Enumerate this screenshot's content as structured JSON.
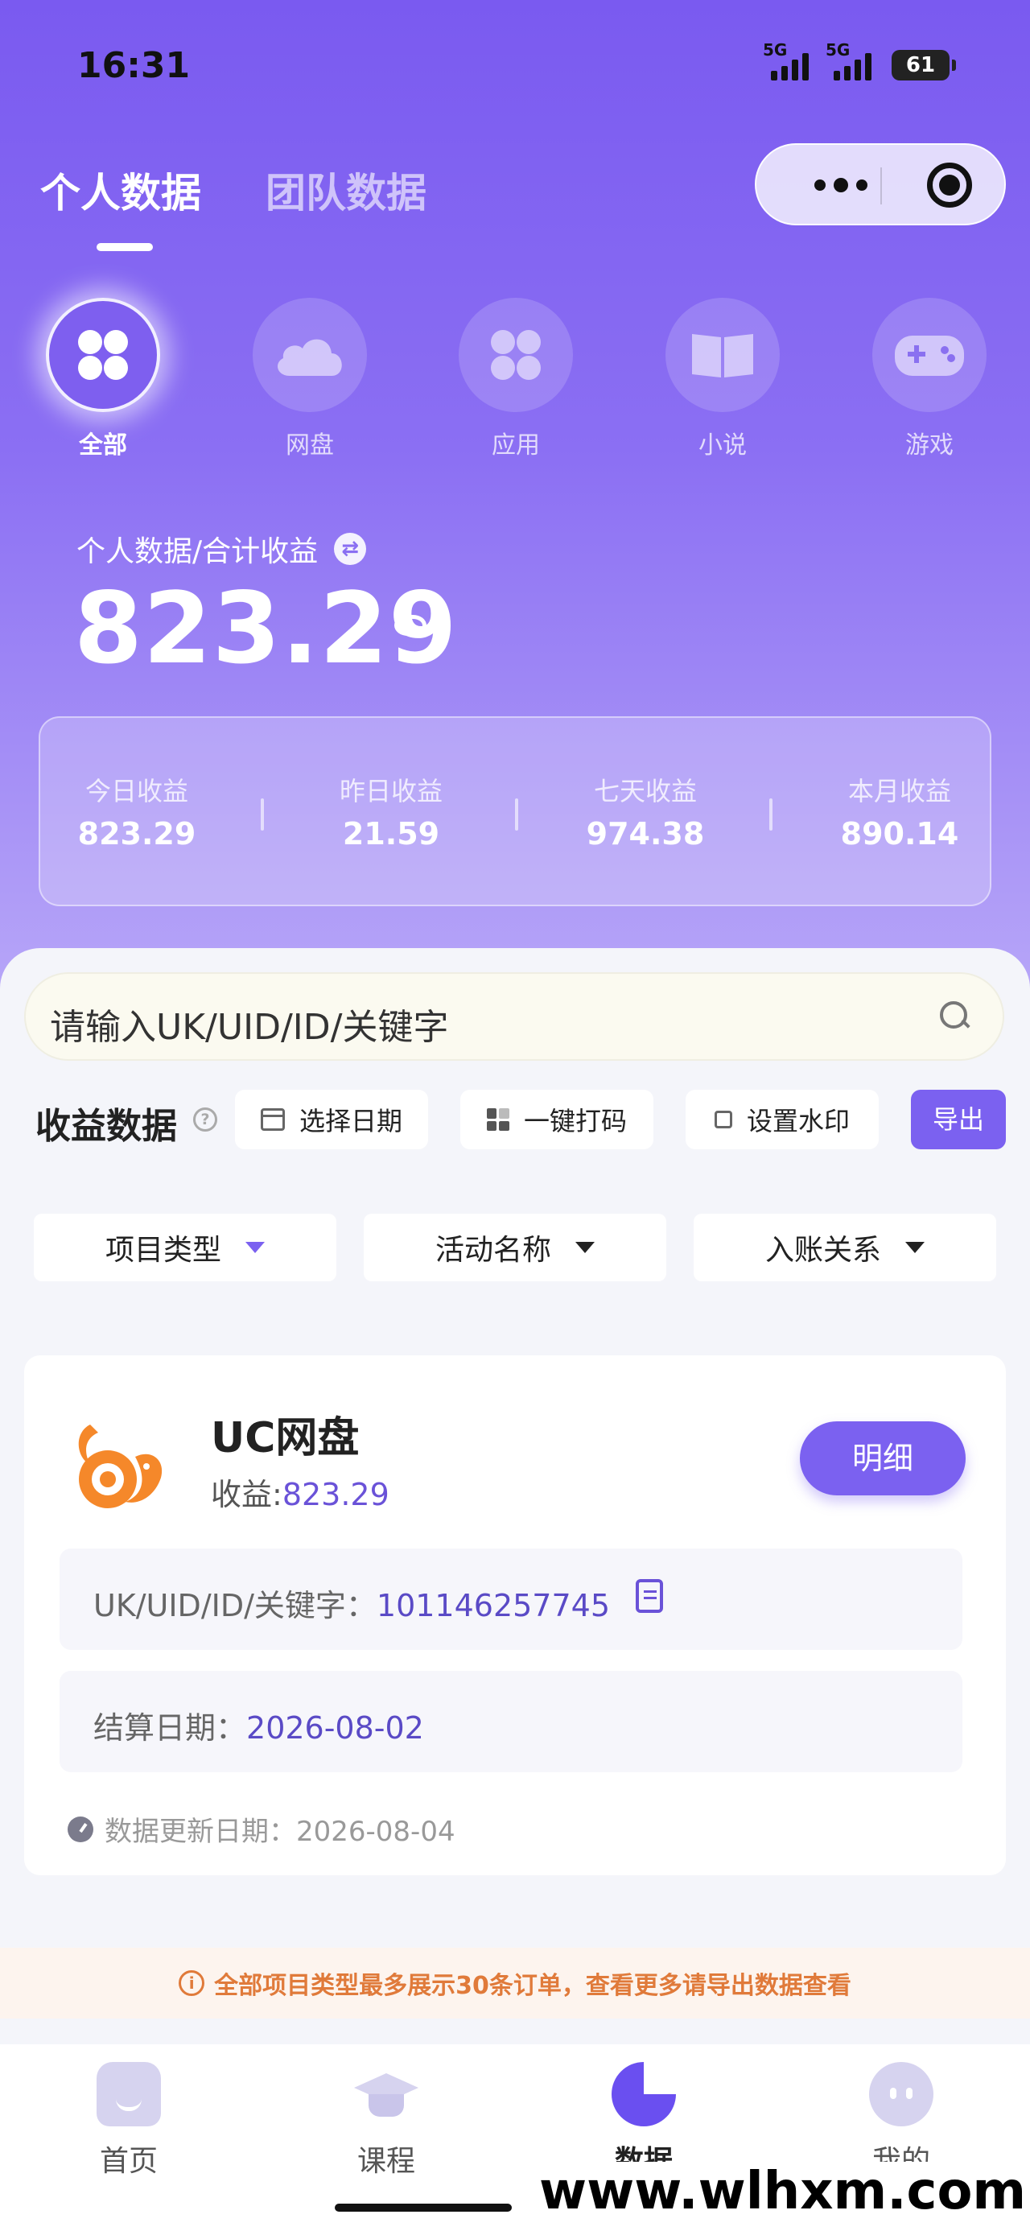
{
  "status_bar": {
    "time": "16:31",
    "network_1": "5G",
    "network_2": "5G",
    "battery": "61"
  },
  "header": {
    "tabs": [
      {
        "label": "个人数据",
        "active": true
      },
      {
        "label": "团队数据",
        "active": false
      }
    ]
  },
  "categories": [
    {
      "label": "全部",
      "icon": "clover-icon",
      "active": true
    },
    {
      "label": "网盘",
      "icon": "cloud-icon",
      "active": false
    },
    {
      "label": "应用",
      "icon": "apps-icon",
      "active": false
    },
    {
      "label": "小说",
      "icon": "book-icon",
      "active": false
    },
    {
      "label": "游戏",
      "icon": "gamepad-icon",
      "active": false
    }
  ],
  "summary": {
    "label": "个人数据/合计收益",
    "total": "823.29",
    "stats": [
      {
        "label": "今日收益",
        "value": "823.29"
      },
      {
        "label": "昨日收益",
        "value": "21.59"
      },
      {
        "label": "七天收益",
        "value": "974.38"
      },
      {
        "label": "本月收益",
        "value": "890.14"
      }
    ]
  },
  "search": {
    "placeholder": "请输入UK/UID/ID/关键字"
  },
  "toolbar": {
    "title": "收益数据",
    "help": "?",
    "select_date": "选择日期",
    "mask_code": "一键打码",
    "watermark": "设置水印",
    "export": "导出"
  },
  "filters": [
    {
      "label": "项目类型"
    },
    {
      "label": "活动名称"
    },
    {
      "label": "入账关系"
    }
  ],
  "record": {
    "name": "UC网盘",
    "earn_label": "收益:",
    "earn_value": "823.29",
    "detail_button": "明细",
    "key_label": "UK/UID/ID/关键字：",
    "key_value": "101146257745",
    "settle_label": "结算日期：",
    "settle_value": "2026-08-02",
    "update_text": "数据更新日期：2026-08-04"
  },
  "notice": {
    "icon": "i",
    "text": "全部项目类型最多展示30条订单，查看更多请导出数据查看"
  },
  "tabbar": [
    {
      "label": "首页",
      "active": false
    },
    {
      "label": "课程",
      "active": false
    },
    {
      "label": "数据",
      "active": true
    },
    {
      "label": "我的",
      "active": false
    }
  ],
  "watermark": "www.wlhxm.com",
  "colors": {
    "accent": "#7b61f0",
    "hero_top": "#7a5af0",
    "notice": "#e07a3a",
    "value_text": "#5a4ac6"
  }
}
